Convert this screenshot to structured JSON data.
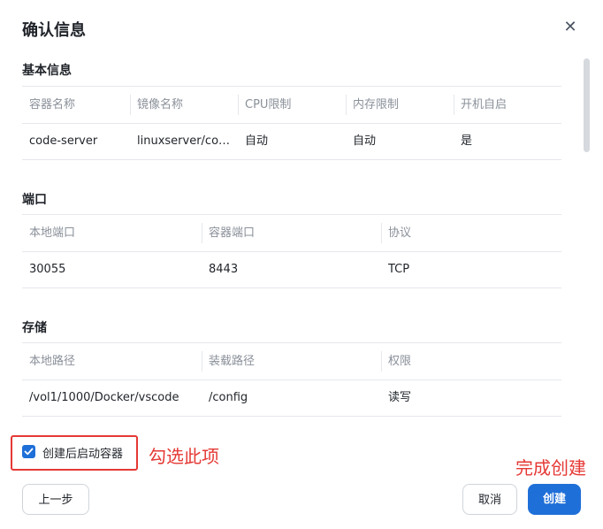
{
  "dialog": {
    "title": "确认信息",
    "close_icon": "close-icon"
  },
  "basic": {
    "title": "基本信息",
    "headers": [
      "容器名称",
      "镜像名称",
      "CPU限制",
      "内存限制",
      "开机自启"
    ],
    "row": [
      "code-server",
      "linuxserver/code-server",
      "自动",
      "自动",
      "是"
    ]
  },
  "ports": {
    "title": "端口",
    "headers": [
      "本地端口",
      "容器端口",
      "协议"
    ],
    "row": [
      "30055",
      "8443",
      "TCP"
    ]
  },
  "storage": {
    "title": "存储",
    "headers": [
      "本地路径",
      "装载路径",
      "权限"
    ],
    "row": [
      "/vol1/1000/Docker/vscode",
      "/config",
      "读写"
    ]
  },
  "start_after_create": {
    "label": "创建后启动容器",
    "checked": true
  },
  "annotations": {
    "check_hint": "勾选此项",
    "finish_hint": "完成创建"
  },
  "footer": {
    "prev_label": "上一步",
    "cancel_label": "取消",
    "create_label": "创建"
  },
  "colors": {
    "accent": "#1f6fd8",
    "annotation": "#e53935"
  }
}
